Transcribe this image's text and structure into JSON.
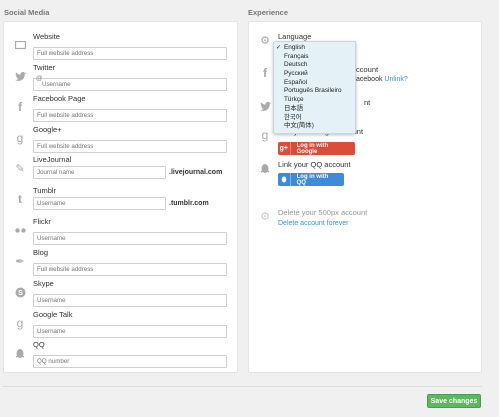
{
  "social": {
    "title": "Social Media",
    "items": [
      {
        "label": "Website",
        "placeholder": "Full website address",
        "icon": "monitor-icon"
      },
      {
        "label": "Twitter",
        "placeholder": "Username",
        "icon": "twitter-icon"
      },
      {
        "label": "Facebook Page",
        "placeholder": "Full website address",
        "icon": "facebook-icon"
      },
      {
        "label": "Google+",
        "placeholder": "Full website address",
        "icon": "google-plus-icon"
      },
      {
        "label": "LiveJournal",
        "placeholder": "Journal name",
        "suffix": ".livejournal.com",
        "icon": "pencil-icon"
      },
      {
        "label": "Tumblr",
        "placeholder": "Username",
        "suffix": ".tumblr.com",
        "icon": "tumblr-icon"
      },
      {
        "label": "Flickr",
        "placeholder": "Username",
        "icon": "flickr-icon"
      },
      {
        "label": "Blog",
        "placeholder": "Full website address",
        "icon": "pen-icon"
      },
      {
        "label": "Skype",
        "placeholder": "Username",
        "icon": "skype-icon"
      },
      {
        "label": "Google Talk",
        "placeholder": "Username",
        "icon": "google-talk-icon"
      },
      {
        "label": "QQ",
        "placeholder": "QQ number",
        "icon": "qq-icon"
      }
    ],
    "twitter_prefix": "@"
  },
  "experience": {
    "title": "Experience",
    "language_label": "Language",
    "facebook_partial": "ccount",
    "facebook_line2_prefix": "acebook",
    "unlink": "Unlink?",
    "twitter_partial": "nt",
    "google_partial": "Link your Google account",
    "google_button": "Log in with Google",
    "qq_label": "Link your QQ account",
    "qq_button": "Log in with QQ",
    "delete_label": "Delete your 500px account",
    "delete_link": "Delete account forever"
  },
  "languages": [
    {
      "name": "English",
      "selected": true
    },
    {
      "name": "Français"
    },
    {
      "name": "Deutsch"
    },
    {
      "name": "Русский"
    },
    {
      "name": "Español"
    },
    {
      "name": "Português Brasileiro"
    },
    {
      "name": "Türkçe"
    },
    {
      "name": "日本語"
    },
    {
      "name": "한국어"
    },
    {
      "name": "中文(简体)"
    }
  ],
  "save_label": "Save changes",
  "colors": {
    "google": "#dd4b39",
    "qq": "#3d8bd9",
    "save": "#5cb85c",
    "link": "#3b8fd6"
  }
}
